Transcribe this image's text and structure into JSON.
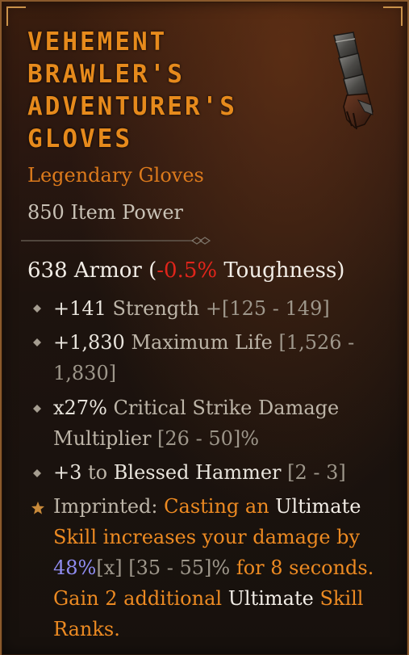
{
  "item": {
    "title_lines": [
      "VEHEMENT",
      "BRAWLER'S",
      "ADVENTURER'S",
      "GLOVES"
    ],
    "type": "Legendary Gloves",
    "item_power": "850 Item Power",
    "icon": "gauntlet-icon"
  },
  "armor": {
    "prefix": "638 Armor (",
    "delta": "-0.5%",
    "suffix": " Toughness)"
  },
  "stats": [
    {
      "value": "+141",
      "name": " Strength ",
      "range": "+[125 - 149]"
    },
    {
      "value": "+1,830",
      "name": " Maximum Life ",
      "range": "[1,526 - 1,830]"
    },
    {
      "value": "x27%",
      "name": " Critical Strike Damage Multiplier ",
      "range": "[26 - 50]%"
    },
    {
      "value": "+3",
      "name": " to ",
      "value2": "Blessed Hammer",
      "range": " [2 - 3]"
    }
  ],
  "aspect": {
    "icon": "star-icon",
    "label": "Imprinted: ",
    "t1": "Casting an ",
    "t2": "Ultimate",
    "t3": " Skill increases your damage by ",
    "t4": "48%",
    "t5": "[x]",
    "t6": " [35 - 55]%",
    "t7": " for 8 seconds. Gain 2 additional ",
    "t8": "Ultimate",
    "t9": " Skill Ranks."
  },
  "colors": {
    "title": "#e68a1c",
    "legendary": "#dc7a1c",
    "negative": "#e0251b",
    "aspect": "#ec8a22",
    "roll_value": "#8f8cf0",
    "border": "#8a5a2c"
  }
}
